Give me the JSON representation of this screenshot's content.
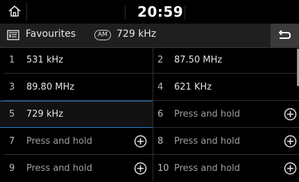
{
  "status_bar": {
    "time": "20:59"
  },
  "header": {
    "title": "Favourites",
    "band": "AM",
    "frequency": "729 kHz"
  },
  "presets": [
    {
      "number": "1",
      "label": "531 kHz"
    },
    {
      "number": "2",
      "label": "87.50 MHz"
    },
    {
      "number": "3",
      "label": "89.80 MHz"
    },
    {
      "number": "4",
      "label": "621 KHz"
    },
    {
      "number": "5",
      "label": "729 kHz"
    },
    {
      "number": "6",
      "label": "Press and hold"
    },
    {
      "number": "7",
      "label": "Press and hold"
    },
    {
      "number": "8",
      "label": "Press and hold"
    },
    {
      "number": "9",
      "label": "Press and hold"
    },
    {
      "number": "10",
      "label": "Press and hold"
    }
  ],
  "icons": {
    "home": "home-icon",
    "favourites": "favourites-list-icon",
    "back": "back-icon",
    "add": "plus-circle-icon"
  },
  "colors": {
    "selection": "#2b7fd3",
    "background": "#000000",
    "header": "#1f1f1f"
  }
}
